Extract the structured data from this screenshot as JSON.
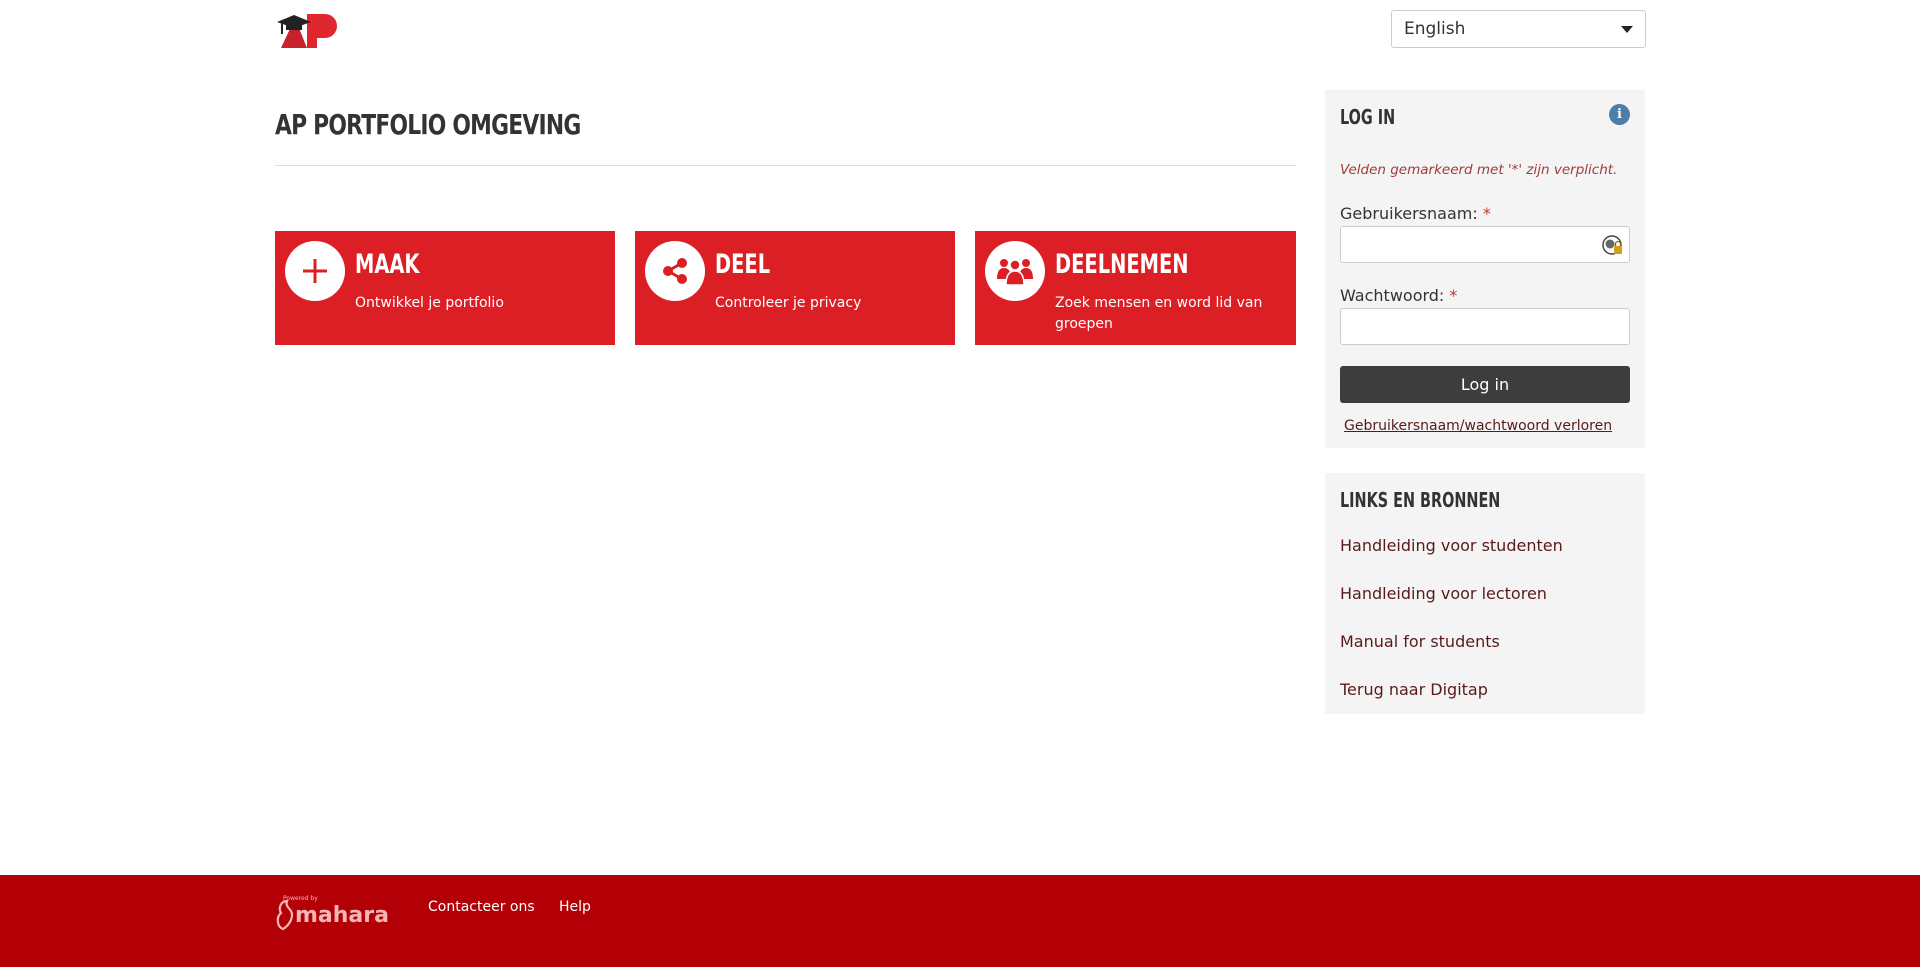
{
  "header": {
    "language": {
      "selected": "English"
    }
  },
  "main": {
    "title": "AP PORTFOLIO OMGEVING",
    "tiles": [
      {
        "heading": "MAAK",
        "text": "Ontwikkel je portfolio",
        "icon": "plus-icon"
      },
      {
        "heading": "DEEL",
        "text": "Controleer je privacy",
        "icon": "share-icon"
      },
      {
        "heading": "DEELNEMEN",
        "text": "Zoek mensen en word lid van groepen",
        "icon": "users-icon"
      }
    ]
  },
  "login": {
    "heading": "LOG IN",
    "required_note": "Velden gemarkeerd met '*' zijn verplicht.",
    "username_label": "Gebruikersnaam:",
    "password_label": "Wachtwoord:",
    "required_mark": "*",
    "username_value": "",
    "password_value": "",
    "button_label": "Log in",
    "forgot_link": "Gebruikersnaam/wachtwoord verloren"
  },
  "links": {
    "heading": "LINKS EN BRONNEN",
    "items": [
      "Handleiding voor studenten",
      "Handleiding voor lectoren",
      "Manual for students",
      "Terug naar Digitap"
    ]
  },
  "footer": {
    "logo_text": "mahara",
    "logo_small_text": "Powered by",
    "links": [
      "Contacteer ons",
      "Help"
    ]
  },
  "colors": {
    "brand_red": "#dc1f25",
    "footer_red": "#b30006",
    "button_dark": "#3d3d3d",
    "info_blue": "#4d7ea8"
  }
}
